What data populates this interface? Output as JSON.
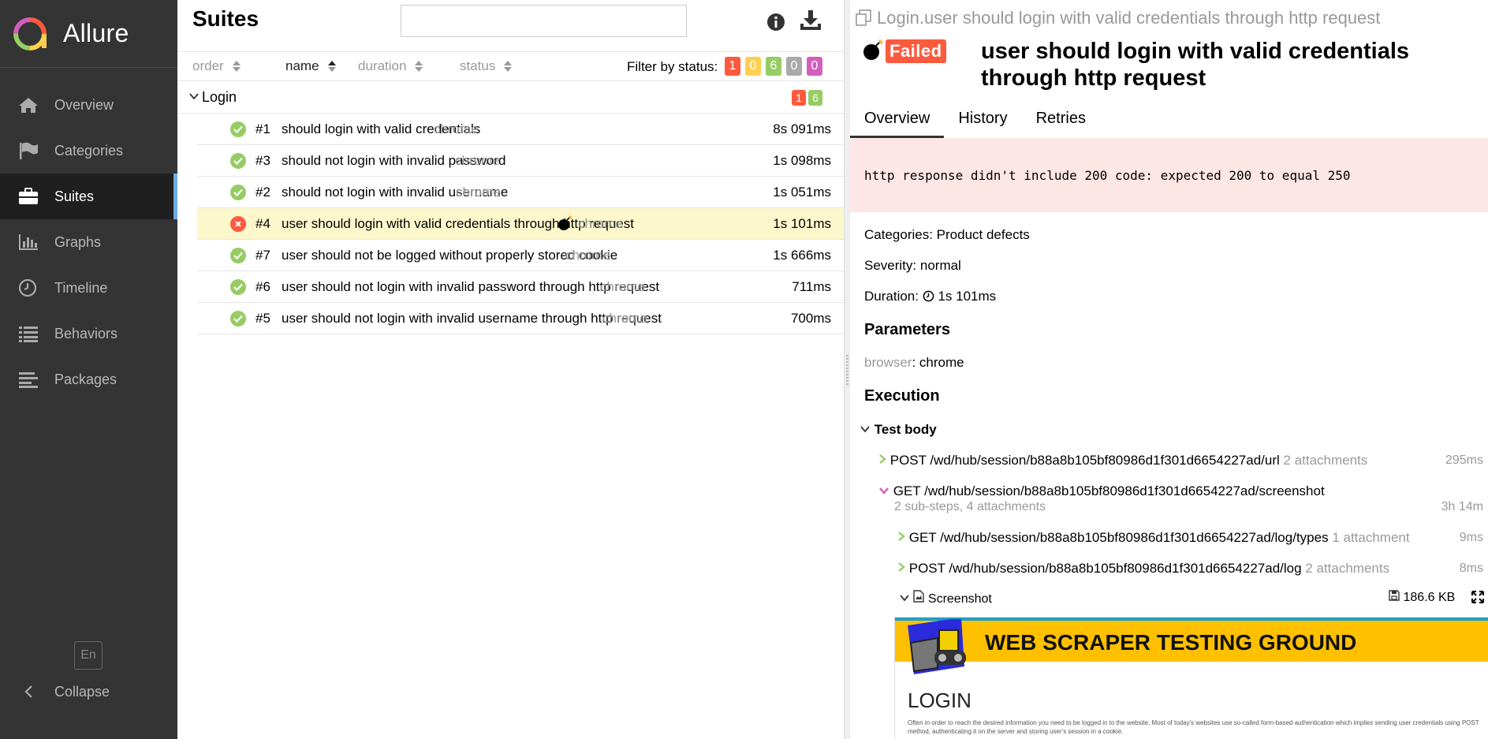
{
  "app": {
    "name": "Allure"
  },
  "sidebar": {
    "items": [
      {
        "label": "Overview",
        "icon": "home-icon"
      },
      {
        "label": "Categories",
        "icon": "flag-icon"
      },
      {
        "label": "Suites",
        "icon": "briefcase-icon",
        "active": true
      },
      {
        "label": "Graphs",
        "icon": "bar-chart-icon"
      },
      {
        "label": "Timeline",
        "icon": "clock-icon"
      },
      {
        "label": "Behaviors",
        "icon": "list-icon"
      },
      {
        "label": "Packages",
        "icon": "align-left-icon"
      }
    ],
    "lang": "En",
    "collapse": "Collapse"
  },
  "suites": {
    "title": "Suites",
    "search_value": "",
    "sort": {
      "order": "order",
      "name": "name",
      "duration": "duration",
      "status": "status"
    },
    "filter_label": "Filter by status:",
    "filter_counts": [
      "1",
      "0",
      "6",
      "0",
      "0"
    ],
    "group": {
      "name": "Login",
      "failed": "1",
      "passed": "6"
    },
    "rows": [
      {
        "num": "#1",
        "name": "should login with valid credentials",
        "tag": "chrome",
        "duration": "8s 091ms",
        "status": "passed"
      },
      {
        "num": "#3",
        "name": "should not login with invalid password",
        "tag": "chrome",
        "duration": "1s 098ms",
        "status": "passed"
      },
      {
        "num": "#2",
        "name": "should not login with invalid username",
        "tag": "chrome",
        "duration": "1s 051ms",
        "status": "passed"
      },
      {
        "num": "#4",
        "name": "user should login with valid credentials through http request",
        "tag": "chrome",
        "duration": "1s 101ms",
        "status": "failed"
      },
      {
        "num": "#7",
        "name": "user should not be logged without properly stored cookie",
        "tag": "chrome",
        "duration": "1s 666ms",
        "status": "passed"
      },
      {
        "num": "#6",
        "name": "user should not login with invalid password through http request",
        "tag": "chrome",
        "duration": "711ms",
        "status": "passed"
      },
      {
        "num": "#5",
        "name": "user should not login with invalid username through http request",
        "tag": "chrome",
        "duration": "700ms",
        "status": "passed"
      }
    ]
  },
  "detail": {
    "breadcrumb": "Login.user should login with valid credentials through http request",
    "status": "Failed",
    "title": "user should login with valid credentials through http request",
    "tabs": [
      "Overview",
      "History",
      "Retries"
    ],
    "error": "http response didn't include 200 code: expected 200 to equal 250",
    "categories_label": "Categories:",
    "categories_value": "Product defects",
    "severity_label": "Severity:",
    "severity_value": "normal",
    "duration_label": "Duration:",
    "duration_value": "1s 101ms",
    "parameters_title": "Parameters",
    "param_name": "browser",
    "param_value": "chrome",
    "execution_title": "Execution",
    "test_body": "Test body",
    "steps": [
      {
        "text": "POST /wd/hub/session/b88a8b105bf80986d1f301d6654227ad/url",
        "att": "2 attachments",
        "dur": "295ms"
      },
      {
        "text": "GET /wd/hub/session/b88a8b105bf80986d1f301d6654227ad/screenshot",
        "sub": "2 sub-steps, 4 attachments",
        "dur": "3h 14m"
      },
      {
        "text": "GET /wd/hub/session/b88a8b105bf80986d1f301d6654227ad/log/types",
        "att": "1 attachment",
        "dur": "9ms"
      },
      {
        "text": "POST /wd/hub/session/b88a8b105bf80986d1f301d6654227ad/log",
        "att": "2 attachments",
        "dur": "8ms"
      }
    ],
    "attachment": {
      "name": "Screenshot",
      "size": "186.6 KB"
    },
    "screenshot": {
      "banner": "WEB SCRAPER TESTING GROUND",
      "heading": "LOGIN",
      "paragraph": "Often in order to reach the desired information you need to be logged in to the website. Most of today's websites use so-called form-based authentication which implies sending user credentials using POST method, authenticating it on the server and storing user's session in a cookie."
    }
  },
  "colors": {
    "failed": "#fd5a3e",
    "broken": "#ffd050",
    "passed": "#97cc64",
    "skipped": "#aaaaaa",
    "unknown": "#d35ebe",
    "sidebar": "#343434"
  }
}
